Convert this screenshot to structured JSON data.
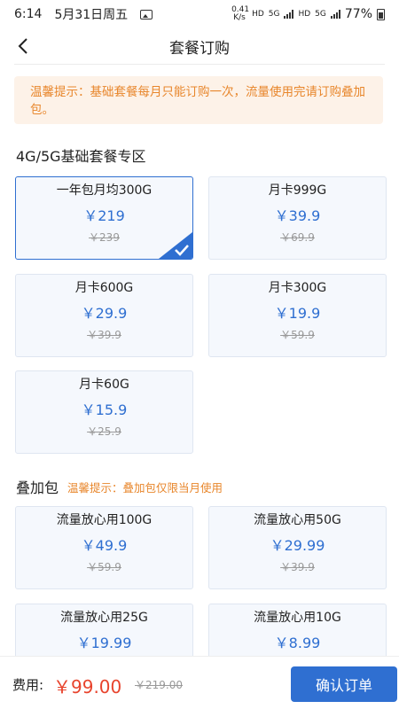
{
  "status_bar": {
    "time": "6:14",
    "date": "5月31日周五",
    "net_speed": "0.41 K/s",
    "net1": "HD",
    "net2": "5G",
    "net3": "HD",
    "net4": "5G",
    "battery": "77%"
  },
  "nav": {
    "title": "套餐订购"
  },
  "notice": {
    "text": "温馨提示：基础套餐每月只能订购一次，流量使用完请订购叠加包。"
  },
  "basic_section": {
    "title": "4G/5G基础套餐专区",
    "packages": [
      {
        "name": "一年包月均300G",
        "price": "￥219",
        "original": "￥239",
        "selected": true
      },
      {
        "name": "月卡999G",
        "price": "￥39.9",
        "original": "￥69.9",
        "selected": false
      },
      {
        "name": "月卡600G",
        "price": "￥29.9",
        "original": "￥39.9",
        "selected": false
      },
      {
        "name": "月卡300G",
        "price": "￥19.9",
        "original": "￥59.9",
        "selected": false
      },
      {
        "name": "月卡60G",
        "price": "￥15.9",
        "original": "￥25.9",
        "selected": false
      }
    ]
  },
  "addon_section": {
    "title": "叠加包",
    "hint": "温馨提示：叠加包仅限当月使用",
    "packages": [
      {
        "name": "流量放心用100G",
        "price": "￥49.9",
        "original": "￥59.9"
      },
      {
        "name": "流量放心用50G",
        "price": "￥29.99",
        "original": "￥39.9"
      },
      {
        "name": "流量放心用25G",
        "price": "￥19.99",
        "original": ""
      },
      {
        "name": "流量放心用10G",
        "price": "￥8.99",
        "original": ""
      }
    ]
  },
  "bottom_bar": {
    "fee_label": "费用:",
    "total": "￥99.00",
    "original_total": "￥219.00",
    "confirm_label": "确认订单"
  },
  "colors": {
    "accent": "#2f6fd1",
    "warning": "#e8862b",
    "price_red": "#e8442d"
  },
  "icons": {
    "back": "chevron-left-icon",
    "check": "check-icon"
  }
}
